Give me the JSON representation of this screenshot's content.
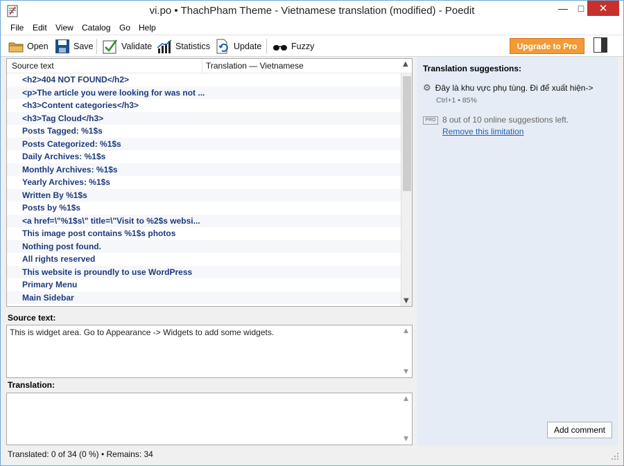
{
  "window": {
    "title": "vi.po • ThachPham Theme - Vietnamese translation (modified) - Poedit",
    "minimize": "—",
    "maximize": "□",
    "close": "✕"
  },
  "menu": [
    "File",
    "Edit",
    "View",
    "Catalog",
    "Go",
    "Help"
  ],
  "toolbar": {
    "open": "Open",
    "save": "Save",
    "validate": "Validate",
    "statistics": "Statistics",
    "update": "Update",
    "fuzzy": "Fuzzy",
    "upgrade": "Upgrade to Pro"
  },
  "list": {
    "col_source": "Source text",
    "col_translation": "Translation — Vietnamese",
    "rows": [
      "<h2>404 NOT FOUND</h2>",
      "<p>The article you were looking for was not ...",
      "<h3>Content categories</h3>",
      "<h3>Tag Cloud</h3>",
      "Posts Tagged: %1$s",
      "Posts Categorized: %1$s",
      "Daily Archives: %1$s",
      "Monthly Archives: %1$s",
      "Yearly Archives: %1$s",
      "Written By %1$s",
      "Posts by %1$s",
      "<a href=\\\"%1$s\\\" title=\\\"Visit to %2$s websi...",
      "This image post contains %1$s photos",
      "Nothing post found.",
      "All rights reserved",
      "This website is proundly to use WordPress",
      "Primary Menu",
      "Main Sidebar"
    ]
  },
  "source": {
    "label": "Source text:",
    "text": "This is widget area. Go to Appearance -> Widgets to add some widgets."
  },
  "translation": {
    "label": "Translation:",
    "text": ""
  },
  "status": "Translated: 0 of 34 (0 %)  •  Remains: 34",
  "sidebar": {
    "title": "Translation suggestions:",
    "suggestion": "Đây là khu vực phụ tùng. Đi để xuất hiện->",
    "suggestion_meta": "Ctrl+1 • 85%",
    "pro_badge": "PRO",
    "limit_text": "8 out of 10 online suggestions left.",
    "remove_link": "Remove this limitation",
    "add_comment": "Add comment"
  },
  "colors": {
    "accent": "#f29a36",
    "close": "#c7302c",
    "row_text": "#1d3a7a",
    "link": "#1f5fb0"
  }
}
